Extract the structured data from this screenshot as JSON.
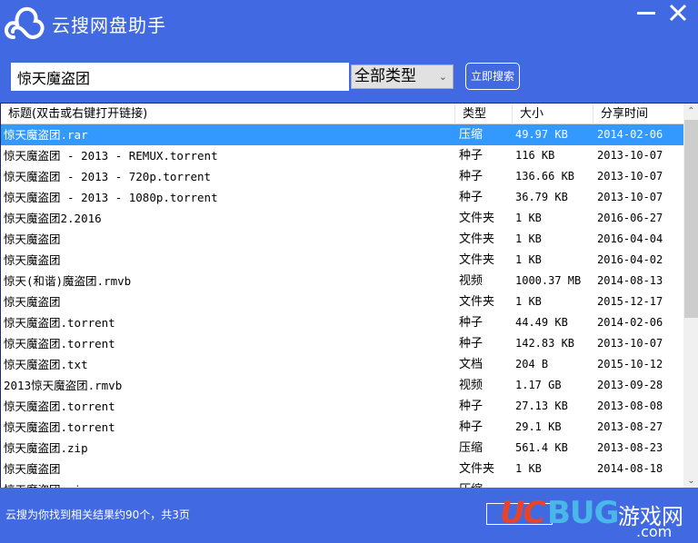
{
  "app": {
    "title": "云搜网盘助手",
    "logo_icon": "cloud-icon",
    "minimize_icon": "minimize-icon",
    "close_icon": "close-icon"
  },
  "search": {
    "query": "惊天魔盗团",
    "type_selected": "全部类型",
    "button_label": "立即搜索"
  },
  "table": {
    "columns": [
      {
        "key": "title",
        "label": "标题(双击或右键打开链接)"
      },
      {
        "key": "type",
        "label": "类型"
      },
      {
        "key": "size",
        "label": "大小"
      },
      {
        "key": "date",
        "label": "分享时间"
      }
    ],
    "selected_index": 0,
    "rows": [
      {
        "title": "惊天魔盗团.rar",
        "type": "压缩",
        "size": "49.97 KB",
        "date": "2014-02-06"
      },
      {
        "title": "惊天魔盗团 - 2013 - REMUX.torrent",
        "type": "种子",
        "size": "116 KB",
        "date": "2013-10-07"
      },
      {
        "title": "惊天魔盗团 - 2013 - 720p.torrent",
        "type": "种子",
        "size": "136.66 KB",
        "date": "2013-10-07"
      },
      {
        "title": "惊天魔盗团 - 2013 - 1080p.torrent",
        "type": "种子",
        "size": "36.79 KB",
        "date": "2013-10-07"
      },
      {
        "title": "惊天魔盗团2.2016",
        "type": "文件夹",
        "size": "1 KB",
        "date": "2016-06-27"
      },
      {
        "title": "惊天魔盗团",
        "type": "文件夹",
        "size": "1 KB",
        "date": "2016-04-04"
      },
      {
        "title": "惊天魔盗团",
        "type": "文件夹",
        "size": "1 KB",
        "date": "2016-04-02"
      },
      {
        "title": "惊天(和谐)魔盗团.rmvb",
        "type": "视频",
        "size": "1000.37 MB",
        "date": "2014-08-13"
      },
      {
        "title": "惊天魔盗团",
        "type": "文件夹",
        "size": "1 KB",
        "date": "2015-12-17"
      },
      {
        "title": "惊天魔盗团.torrent",
        "type": "种子",
        "size": "44.49 KB",
        "date": "2014-02-06"
      },
      {
        "title": "惊天魔盗团.torrent",
        "type": "种子",
        "size": "142.83 KB",
        "date": "2013-10-07"
      },
      {
        "title": "惊天魔盗团.txt",
        "type": "文档",
        "size": "204 B",
        "date": "2015-10-12"
      },
      {
        "title": "2013惊天魔盗团.rmvb",
        "type": "视频",
        "size": "1.17 GB",
        "date": "2013-09-28"
      },
      {
        "title": "惊天魔盗团.torrent",
        "type": "种子",
        "size": "27.13 KB",
        "date": "2013-08-08"
      },
      {
        "title": "惊天魔盗团.torrent",
        "type": "种子",
        "size": "29.1 KB",
        "date": "2013-08-27"
      },
      {
        "title": "惊天魔盗团.zip",
        "type": "压缩",
        "size": "561.4 KB",
        "date": "2013-08-23"
      },
      {
        "title": "惊天魔盗团",
        "type": "文件夹",
        "size": "1 KB",
        "date": "2014-08-18"
      },
      {
        "title": "惊天魔盗团.zip",
        "type": "压缩",
        "size": "",
        "date": ""
      }
    ]
  },
  "scrollbar": {
    "up_icon": "chevron-up-icon",
    "down_icon": "chevron-down-icon"
  },
  "status": {
    "text": "云搜为你找到相关结果约90个，共3页"
  },
  "watermark": {
    "uc": "UC",
    "bug": "BUG",
    "cn": "游戏网",
    "com": ".com"
  },
  "colors": {
    "brand_blue": "#4169e1",
    "selection": "#3399ff"
  }
}
